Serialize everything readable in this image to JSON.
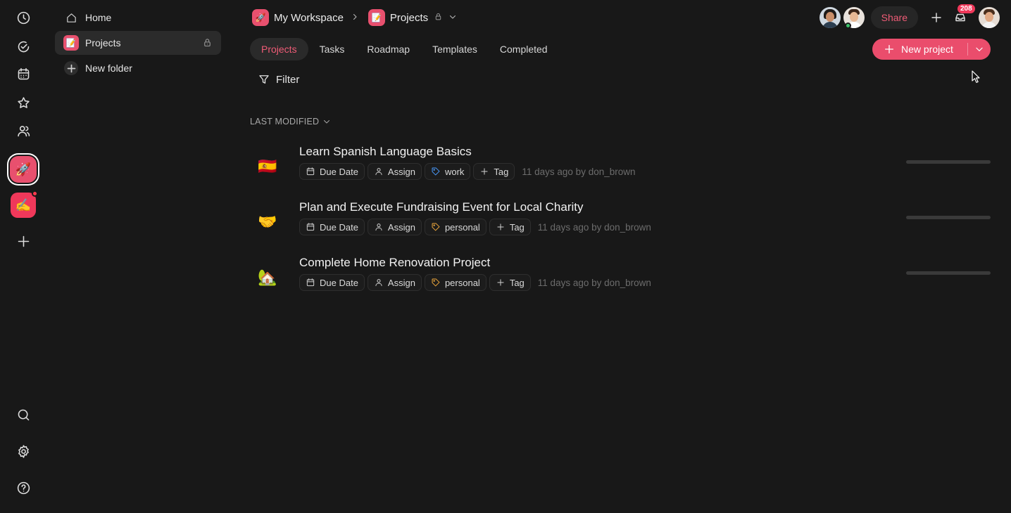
{
  "app": {
    "accent_color": "#ea4d6c",
    "background": "#181818"
  },
  "rail": {
    "items": [
      {
        "icon": "clock-icon"
      },
      {
        "icon": "check-circle-icon"
      },
      {
        "icon": "calendar-icon"
      },
      {
        "icon": "star-icon"
      },
      {
        "icon": "users-icon"
      }
    ],
    "workspaces": [
      {
        "emoji": "🚀",
        "active": true
      },
      {
        "emoji": "✍️",
        "notification": true
      }
    ],
    "bottom": [
      {
        "icon": "search-icon"
      },
      {
        "icon": "gear-icon"
      },
      {
        "icon": "help-icon"
      }
    ]
  },
  "sidebar": {
    "home_label": "Home",
    "projects_label": "Projects",
    "projects_emoji": "📝",
    "new_folder_label": "New folder"
  },
  "header": {
    "workspace_emoji": "🚀",
    "workspace_label": "My Workspace",
    "project_emoji": "📝",
    "project_label": "Projects",
    "share_label": "Share",
    "notifications_count": "208"
  },
  "tabs": [
    {
      "label": "Projects",
      "active": true
    },
    {
      "label": "Tasks"
    },
    {
      "label": "Roadmap"
    },
    {
      "label": "Templates"
    },
    {
      "label": "Completed"
    }
  ],
  "new_project_label": "New project",
  "filter_label": "Filter",
  "sort_label": "LAST MODIFIED",
  "chip_labels": {
    "due_date": "Due Date",
    "assign": "Assign",
    "add_tag": "Tag"
  },
  "projects": [
    {
      "emoji": "🇪🇸",
      "title": "Learn Spanish Language Basics",
      "tag": "work",
      "modified": "11 days ago by don_brown",
      "progress": 0
    },
    {
      "emoji": "🤝",
      "title": "Plan and Execute Fundraising Event for Local Charity",
      "tag": "personal",
      "modified": "11 days ago by don_brown",
      "progress": 0
    },
    {
      "emoji": "🏡",
      "title": "Complete Home Renovation Project",
      "tag": "personal",
      "modified": "11 days ago by don_brown",
      "progress": 0
    }
  ]
}
